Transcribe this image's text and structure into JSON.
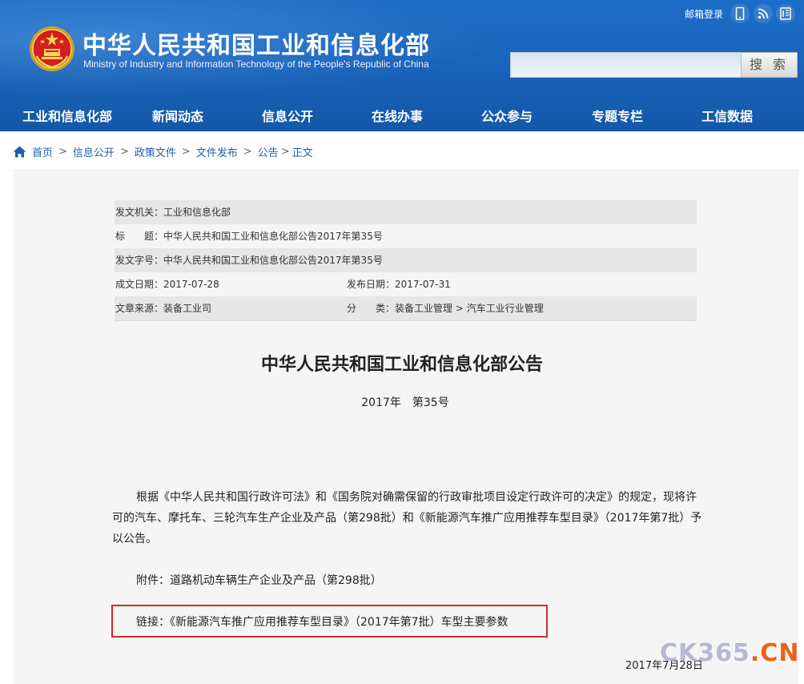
{
  "header": {
    "title": "中华人民共和国工业和信息化部",
    "subtitle": "Ministry of Industry and Information Technology of the People's Republic of China",
    "mail_login": "邮箱登录",
    "search_button": "搜 索",
    "search_value": "",
    "icons": [
      "emblem",
      "mobile-icon",
      "rss-icon",
      "weibo-icon"
    ]
  },
  "nav": {
    "items": [
      "工业和信息化部",
      "新闻动态",
      "信息公开",
      "在线办事",
      "公众参与",
      "专题专栏",
      "工信数据"
    ]
  },
  "breadcrumb": {
    "items": [
      "首页",
      "信息公开",
      "政策文件",
      "文件发布",
      "公告"
    ],
    "current": "正文",
    "separator": ">"
  },
  "meta": {
    "issuer_label": "发文机关：",
    "issuer": "工业和信息化部",
    "title_label": "标　　题：",
    "title": "中华人民共和国工业和信息化部公告2017年第35号",
    "doc_no_label": "发文字号：",
    "doc_no": "中华人民共和国工业和信息化部公告2017年第35号",
    "created_label": "成文日期：",
    "created": "2017-07-28",
    "published_label": "发布日期：",
    "published": "2017-07-31",
    "source_label": "文章来源：",
    "source": "装备工业司",
    "category_label": "分　　类：",
    "category": "装备工业管理 > 汽车工业行业管理"
  },
  "article": {
    "heading": "中华人民共和国工业和信息化部公告",
    "number": "2017年　第35号",
    "body_line1": "根据《中华人民共和国行政许可法》和《国务院对确需保留的行政审批项目设定行政许可的决定》的规定，现将许",
    "body_line2": "可的汽车、摩托车、三轮汽车生产企业及产品（第298批）和《新能源汽车推广应用推荐车型目录》（2017年第7批）予",
    "body_line3": "以公告。",
    "attachment": "附件：道路机动车辆生产企业及产品（第298批）",
    "link": "链接：《新能源汽车推广应用推荐车型目录》（2017年第7批）车型主要参数",
    "date": "2017年7月28日"
  },
  "watermark": {
    "main": "CK365",
    "dot": ".",
    "suffix": "CN"
  },
  "colors": {
    "header_blue": "#1a64bc",
    "link_blue": "#1f5fae",
    "highlight_red": "#d42a2a",
    "watermark_orange": "#e8631a"
  }
}
